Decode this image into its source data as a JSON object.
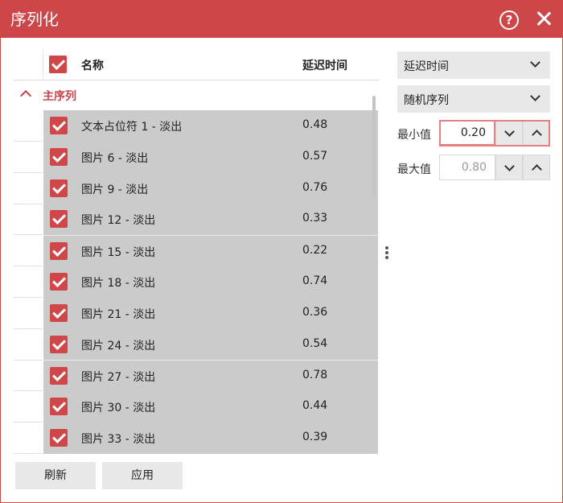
{
  "window": {
    "title": "序列化",
    "help_icon": "?"
  },
  "list": {
    "header": {
      "name_label": "名称",
      "delay_label": "延迟时间",
      "all_checked": true
    },
    "group": {
      "label": "主序列",
      "expanded": true
    },
    "rows": [
      {
        "name": "文本占位符 1 - 淡出",
        "delay": "0.48",
        "checked": true
      },
      {
        "name": "图片 6 - 淡出",
        "delay": "0.57",
        "checked": true
      },
      {
        "name": "图片 9 - 淡出",
        "delay": "0.76",
        "checked": true
      },
      {
        "name": "图片 12 - 淡出",
        "delay": "0.33",
        "checked": true
      },
      {
        "name": "图片 15 - 淡出",
        "delay": "0.22",
        "checked": true
      },
      {
        "name": "图片 18 - 淡出",
        "delay": "0.74",
        "checked": true
      },
      {
        "name": "图片 21 - 淡出",
        "delay": "0.36",
        "checked": true
      },
      {
        "name": "图片 24 - 淡出",
        "delay": "0.54",
        "checked": true
      },
      {
        "name": "图片 27 - 淡出",
        "delay": "0.78",
        "checked": true
      },
      {
        "name": "图片 30 - 淡出",
        "delay": "0.44",
        "checked": true
      },
      {
        "name": "图片 33 - 淡出",
        "delay": "0.39",
        "checked": true
      }
    ]
  },
  "panel": {
    "property_dropdown": "延迟时间",
    "mode_dropdown": "随机序列",
    "min_label": "最小值",
    "min_value": "0.20",
    "max_label": "最大值",
    "max_value": "0.80"
  },
  "buttons": {
    "refresh": "刷新",
    "apply": "应用"
  },
  "colors": {
    "accent": "#cd4648",
    "row_background": "#cbcbcb",
    "focus_border": "#e47f82"
  }
}
